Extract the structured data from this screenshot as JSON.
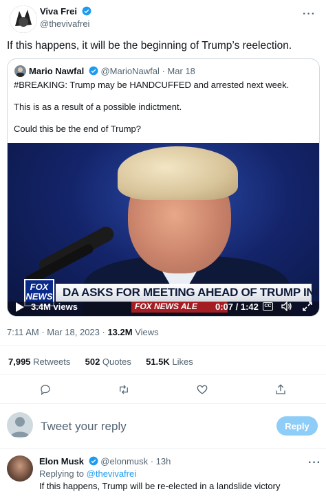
{
  "author": {
    "name": "Viva Frei",
    "handle": "@thevivafrei"
  },
  "tweet": {
    "text": "If this happens, it will be the beginning of Trump’s reelection."
  },
  "quote": {
    "name": "Mario Nawfal",
    "handle_date": "@MarioNawfal · Mar 18",
    "line1": "#BREAKING: Trump may be HANDCUFFED and arrested next week.",
    "line2": "This is as a result of a possible indictment.",
    "line3": "Could this be the end of Trump?",
    "video": {
      "chyron": "DA ASKS FOR MEETING AHEAD OF TRUMP INDICTMENT",
      "logo_text": "FOX NEWS",
      "ticker": "FOX NEWS ALE",
      "views": "3.4M views",
      "time": "0:07 / 1:42",
      "cc": "CC"
    }
  },
  "meta": {
    "time_date": "7:11 AM · Mar 18, 2023 · ",
    "views_count": "13.2M",
    "views_label": " Views"
  },
  "stats": {
    "retweets_count": "7,995",
    "retweets_label": " Retweets",
    "quotes_count": "502",
    "quotes_label": " Quotes",
    "likes_count": "51.5K",
    "likes_label": " Likes"
  },
  "reply_box": {
    "placeholder": "Tweet your reply",
    "button": "Reply"
  },
  "reply": {
    "name": "Elon Musk",
    "handle_time": "@elonmusk · 13h",
    "replying_prefix": "Replying to ",
    "replying_handle": "@thevivafrei",
    "text": "If this happens, Trump will be re-elected in a landslide victory"
  },
  "colors": {
    "accent": "#1d9bf0",
    "verified": "#1d9bf0",
    "reply_button": "#8ecdf8"
  }
}
